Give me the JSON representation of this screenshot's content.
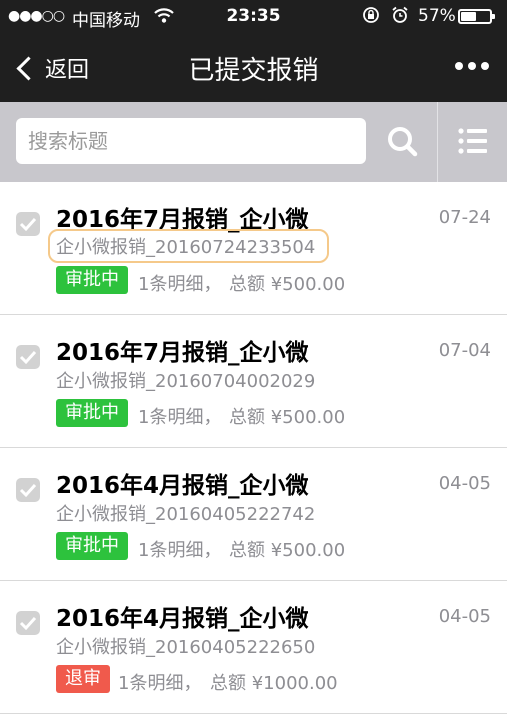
{
  "status_bar": {
    "signal": "●●●○○",
    "carrier": "中国移动",
    "time": "23:35",
    "battery_percent": "57%",
    "battery_level": 0.57
  },
  "nav": {
    "back_label": "返回",
    "title": "已提交报销"
  },
  "search": {
    "placeholder": "搜索标题"
  },
  "colors": {
    "approving_badge": "#2dc23d",
    "returned_badge": "#f05a4c",
    "nav_background": "#1f1f1f"
  },
  "items": [
    {
      "title": "2016年7月报销_企小微",
      "date": "07-24",
      "code": "企小微报销_20160724233504",
      "status": "审批中",
      "count": "1条明细，",
      "total": "总额 ¥500.00"
    },
    {
      "title": "2016年7月报销_企小微",
      "date": "07-04",
      "code": "企小微报销_20160704002029",
      "status": "审批中",
      "count": "1条明细，",
      "total": "总额 ¥500.00"
    },
    {
      "title": "2016年4月报销_企小微",
      "date": "04-05",
      "code": "企小微报销_20160405222742",
      "status": "审批中",
      "count": "1条明细，",
      "total": "总额 ¥500.00"
    },
    {
      "title": "2016年4月报销_企小微",
      "date": "04-05",
      "code": "企小微报销_20160405222650",
      "status": "退审",
      "count": "1条明细，",
      "total": "总额 ¥1000.00"
    }
  ]
}
